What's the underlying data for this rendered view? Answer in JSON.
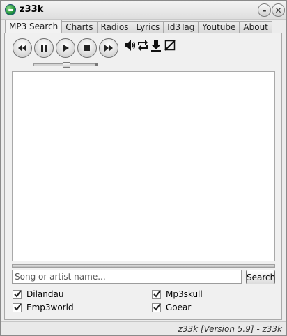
{
  "window": {
    "title": "z33k"
  },
  "tabs": [
    {
      "label": "MP3 Search",
      "active": true
    },
    {
      "label": "Charts",
      "active": false
    },
    {
      "label": "Radios",
      "active": false
    },
    {
      "label": "Lyrics",
      "active": false
    },
    {
      "label": "Id3Tag",
      "active": false
    },
    {
      "label": "Youtube",
      "active": false
    },
    {
      "label": "About",
      "active": false
    }
  ],
  "player": {
    "controls": [
      "rewind-icon",
      "pause-icon",
      "play-icon",
      "stop-icon",
      "fast-forward-icon"
    ],
    "tools": [
      "volume-icon",
      "repeat-icon",
      "download-icon",
      "resize-icon"
    ]
  },
  "search": {
    "placeholder": "Song or artist name...",
    "value": "",
    "button_label": "Search"
  },
  "sources": [
    {
      "label": "Dilandau",
      "checked": true
    },
    {
      "label": "Mp3skull",
      "checked": true
    },
    {
      "label": "Emp3world",
      "checked": true
    },
    {
      "label": "Goear",
      "checked": true
    }
  ],
  "status": {
    "text": "z33k [Version 5.9] - z33k"
  }
}
